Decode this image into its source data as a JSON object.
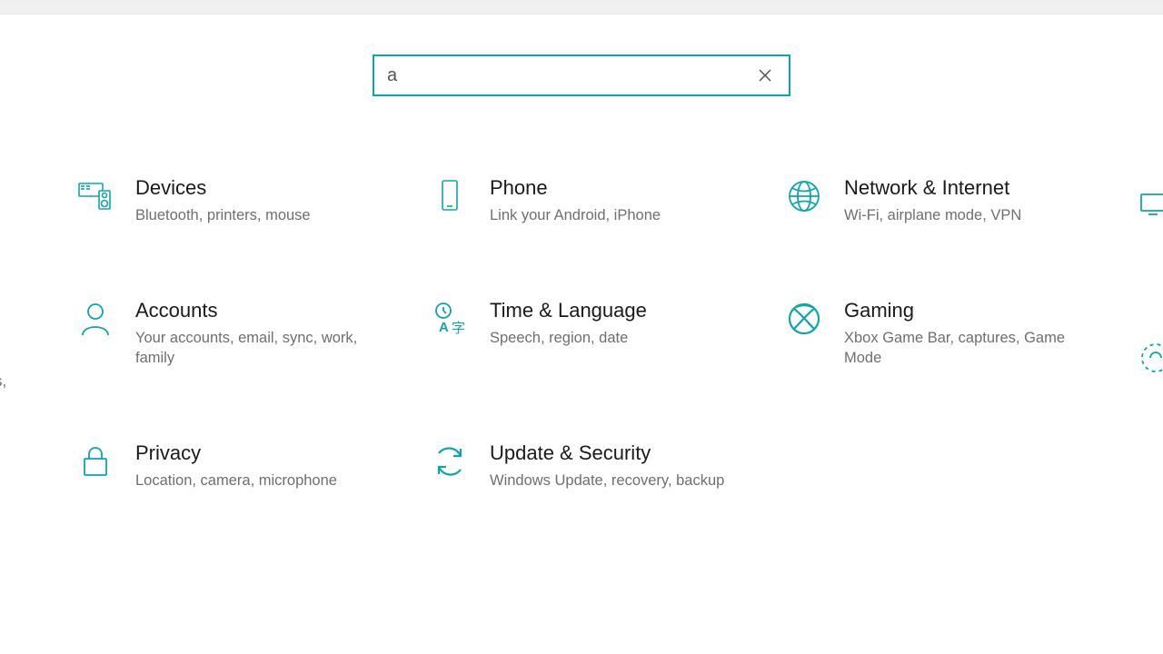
{
  "search": {
    "value": "a",
    "clear_label": "Clear"
  },
  "categories": [
    {
      "title": "Devices",
      "desc": "Bluetooth, printers, mouse"
    },
    {
      "title": "Phone",
      "desc": "Link your Android, iPhone"
    },
    {
      "title": "Network & Internet",
      "desc": "Wi-Fi, airplane mode, VPN"
    },
    {
      "title": "Accounts",
      "desc": "Your accounts, email, sync, work, family"
    },
    {
      "title": "Time & Language",
      "desc": "Speech, region, date"
    },
    {
      "title": "Gaming",
      "desc": "Xbox Game Bar, captures, Game Mode"
    },
    {
      "title": "Privacy",
      "desc": "Location, camera, microphone"
    },
    {
      "title": "Update & Security",
      "desc": "Windows Update, recovery, backup"
    }
  ],
  "partial_left": "s,"
}
